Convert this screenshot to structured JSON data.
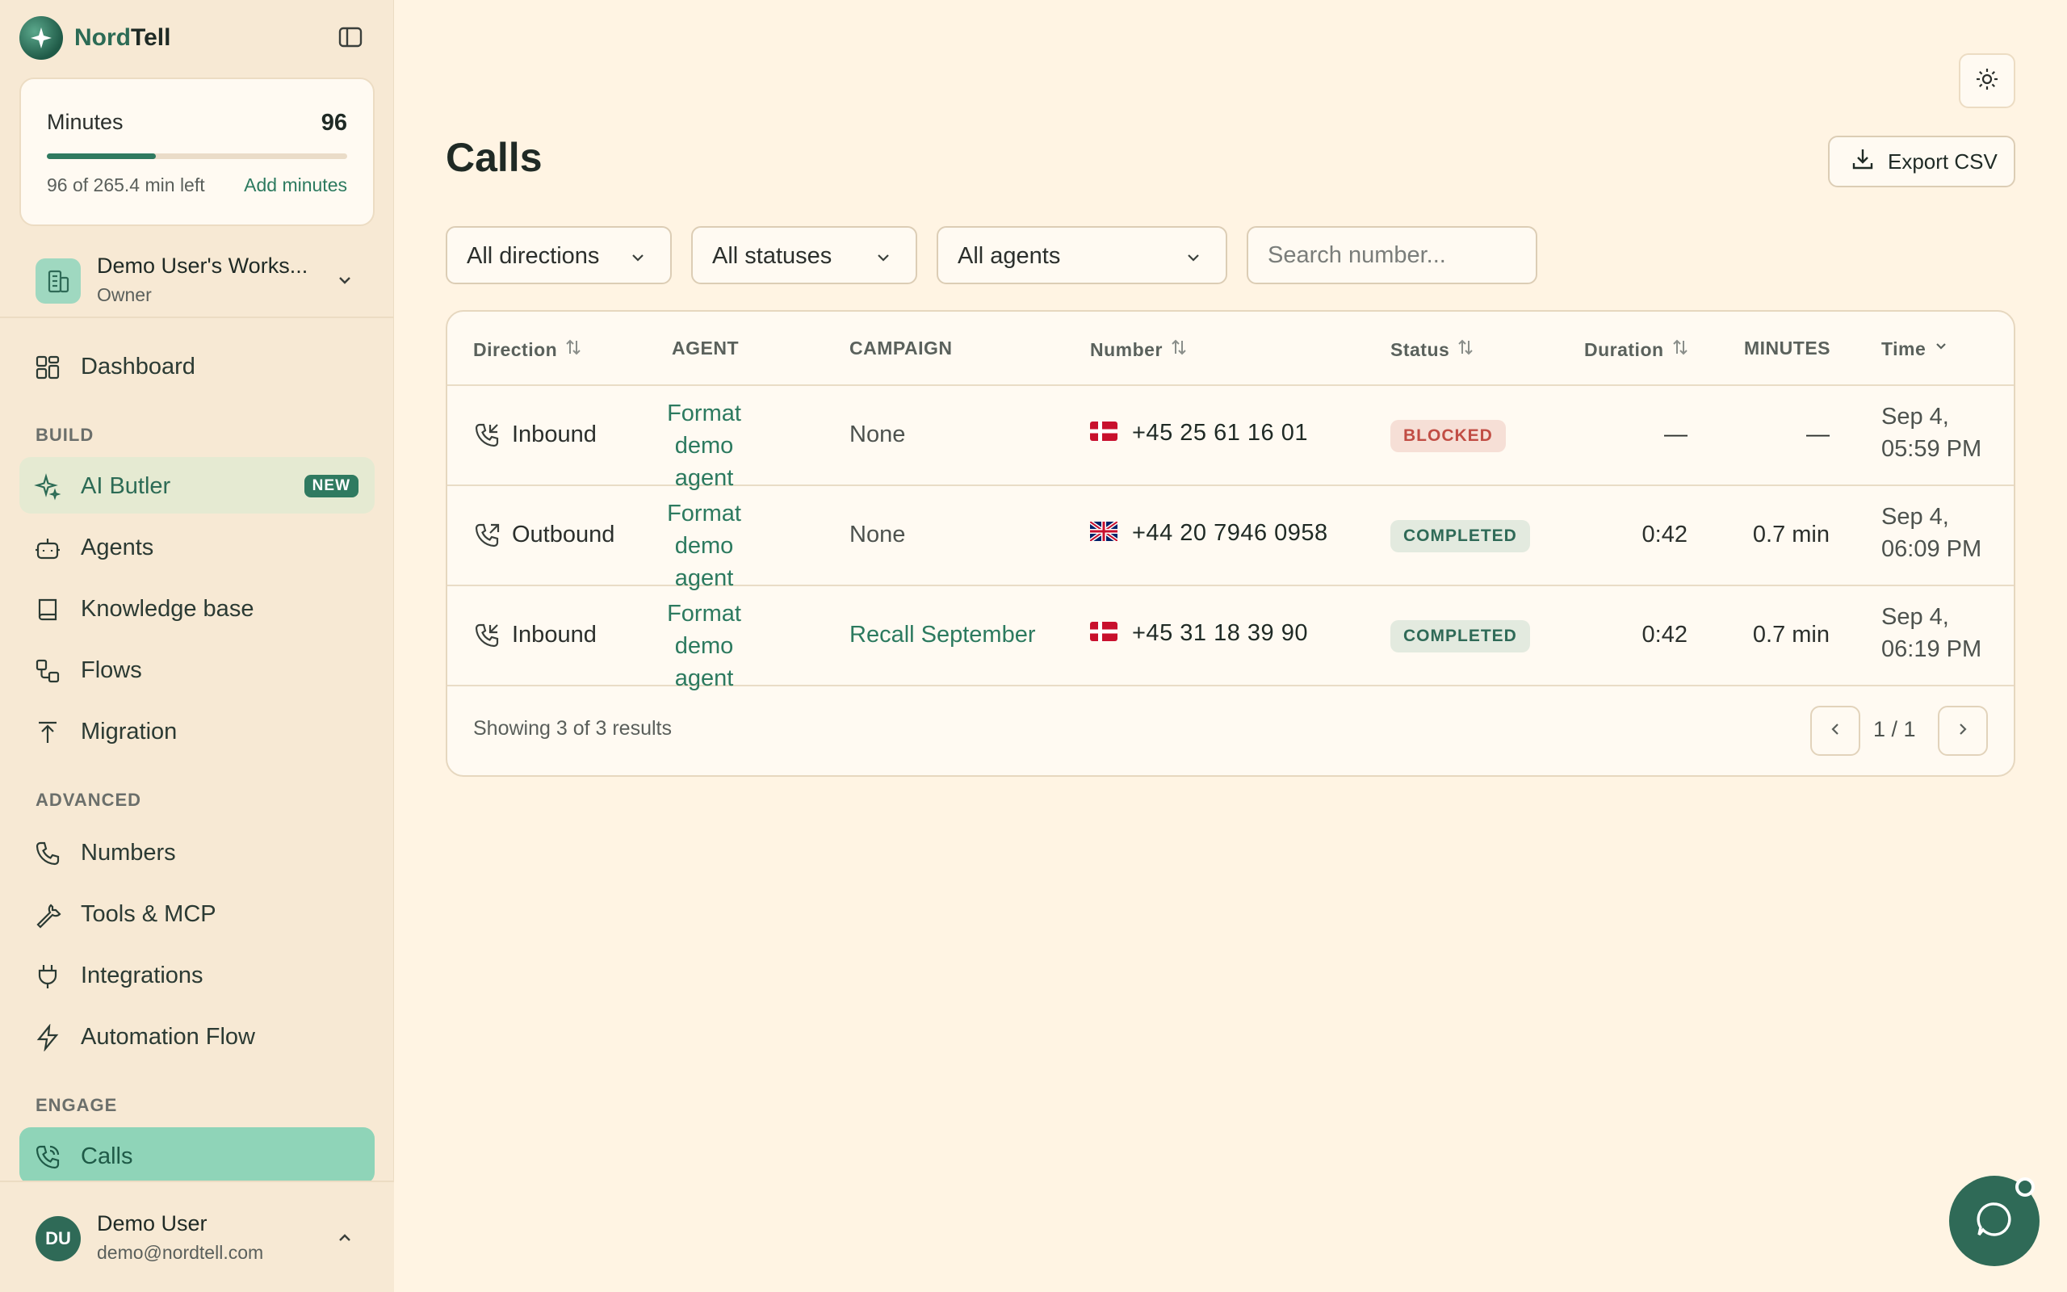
{
  "brand": {
    "name_part1": "Nord",
    "name_part2": "Tell"
  },
  "minutes_card": {
    "label": "Minutes",
    "value": "96",
    "progress_fraction": 0.362,
    "left_text": "96 of 265.4 min left",
    "add_label": "Add minutes"
  },
  "workspace": {
    "name": "Demo User's Works...",
    "role": "Owner"
  },
  "nav": {
    "dashboard": "Dashboard",
    "build_heading": "BUILD",
    "ai_butler": "AI Butler",
    "ai_badge": "NEW",
    "agents": "Agents",
    "knowledge_base": "Knowledge base",
    "flows": "Flows",
    "migration": "Migration",
    "advanced_heading": "ADVANCED",
    "numbers": "Numbers",
    "tools": "Tools & MCP",
    "integrations": "Integrations",
    "automation": "Automation Flow",
    "engage_heading": "ENGAGE",
    "calls": "Calls"
  },
  "user": {
    "initials": "DU",
    "name": "Demo User",
    "email": "demo@nordtell.com"
  },
  "page": {
    "title": "Calls",
    "export_label": "Export CSV"
  },
  "filters": {
    "direction": "All directions",
    "status": "All statuses",
    "agent": "All agents",
    "search_placeholder": "Search number..."
  },
  "table": {
    "headers": {
      "direction": "Direction",
      "agent": "AGENT",
      "campaign": "CAMPAIGN",
      "number": "Number",
      "status": "Status",
      "duration": "Duration",
      "minutes": "MINUTES",
      "time": "Time"
    },
    "rows": [
      {
        "direction": "Inbound",
        "agent_l1": "Format",
        "agent_l2": "demo",
        "agent_l3": "agent",
        "campaign": "None",
        "number": "+45 25 61 16 01",
        "flag": "denmark-flag",
        "status": "BLOCKED",
        "duration": "—",
        "minutes": "—",
        "time_l1": "Sep 4,",
        "time_l2": "05:59 PM"
      },
      {
        "direction": "Outbound",
        "agent_l1": "Format",
        "agent_l2": "demo",
        "agent_l3": "agent",
        "campaign": "None",
        "number": "+44 20 7946 0958",
        "flag": "uk-flag",
        "status": "COMPLETED",
        "duration": "0:42",
        "minutes": "0.7 min",
        "time_l1": "Sep 4,",
        "time_l2": "06:09 PM"
      },
      {
        "direction": "Inbound",
        "agent_l1": "Format",
        "agent_l2": "demo",
        "agent_l3": "agent",
        "campaign": "Recall September",
        "number": "+45 31 18 39 90",
        "flag": "denmark-flag",
        "status": "COMPLETED",
        "duration": "0:42",
        "minutes": "0.7 min",
        "time_l1": "Sep 4,",
        "time_l2": "06:19 PM"
      }
    ],
    "showing": "Showing 3 of 3 results",
    "page_indicator": "1 / 1"
  },
  "colors": {
    "accent": "#2f7a60",
    "background": "#fff4e3",
    "sidebar": "#f7e9d4",
    "active_nav": "#8fd4b8",
    "blocked": "#c14d44"
  }
}
